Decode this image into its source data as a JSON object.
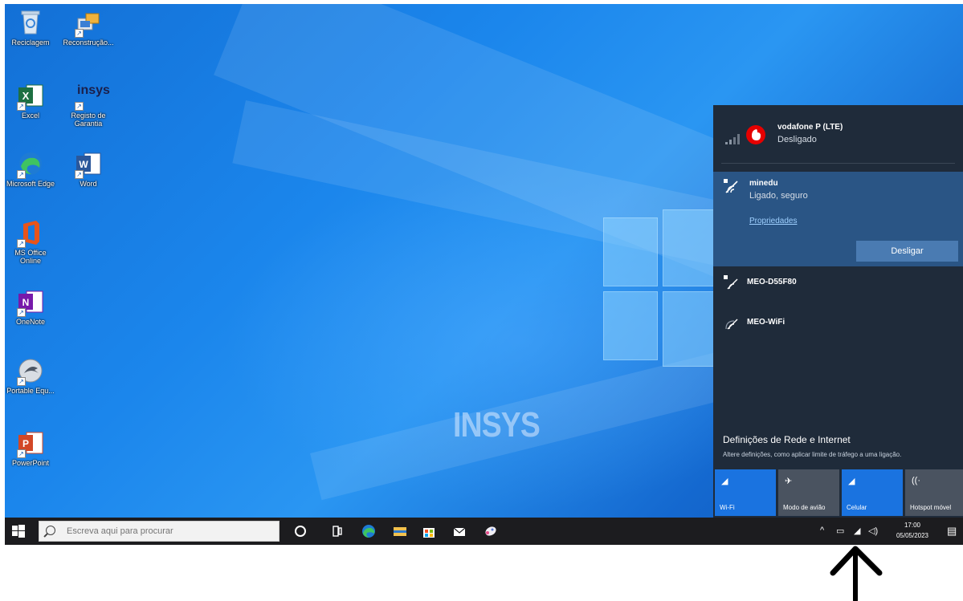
{
  "desktop": {
    "watermark": "INSYS",
    "icons": [
      {
        "label": "Reciclagem",
        "icon": "recycle-bin-icon"
      },
      {
        "label": "Reconstrução...",
        "icon": "network-tool-icon"
      },
      {
        "label": "Excel",
        "icon": "excel-icon"
      },
      {
        "label": "Registo de Garantia",
        "icon": "insys-icon"
      },
      {
        "label": "Microsoft Edge",
        "icon": "edge-icon"
      },
      {
        "label": "Word",
        "icon": "word-icon"
      },
      {
        "label": "MS Office Online",
        "icon": "office-icon"
      },
      {
        "label": "OneNote",
        "icon": "onenote-icon"
      },
      {
        "label": "Portable Equ...",
        "icon": "portable-app-icon"
      },
      {
        "label": "PowerPoint",
        "icon": "powerpoint-icon"
      }
    ],
    "insys_logo_text": "insys"
  },
  "network_flyout": {
    "cellular": {
      "name": "vodafone P (LTE)",
      "status": "Desligado"
    },
    "connected": {
      "name": "minedu",
      "status": "Ligado, seguro",
      "properties_link": "Propriedades",
      "disconnect_label": "Desligar"
    },
    "networks": [
      {
        "name": "MEO-D55F80"
      },
      {
        "name": "MEO-WiFi"
      }
    ],
    "settings_title": "Definições de Rede e Internet",
    "settings_desc": "Altere definições, como aplicar limite de tráfego a uma ligação.",
    "tiles": [
      {
        "label": "Wi-Fi",
        "state": "on"
      },
      {
        "label": "Modo de avião",
        "state": "off"
      },
      {
        "label": "Celular",
        "state": "on"
      },
      {
        "label": "Hotspot móvel",
        "state": "off"
      }
    ]
  },
  "taskbar": {
    "search_placeholder": "Escreva aqui para procurar",
    "clock_time": "17:00",
    "clock_date": "05/05/2023",
    "pinned": [
      "cortana-icon",
      "task-view-icon",
      "edge-icon",
      "file-explorer-icon",
      "store-icon",
      "mail-icon",
      "paint-icon"
    ]
  },
  "colors": {
    "accent": "#1a73e0",
    "flyout_bg": "#1f2b3a",
    "selected_network_bg": "#2a5585",
    "taskbar_bg": "#1c1c1f"
  }
}
